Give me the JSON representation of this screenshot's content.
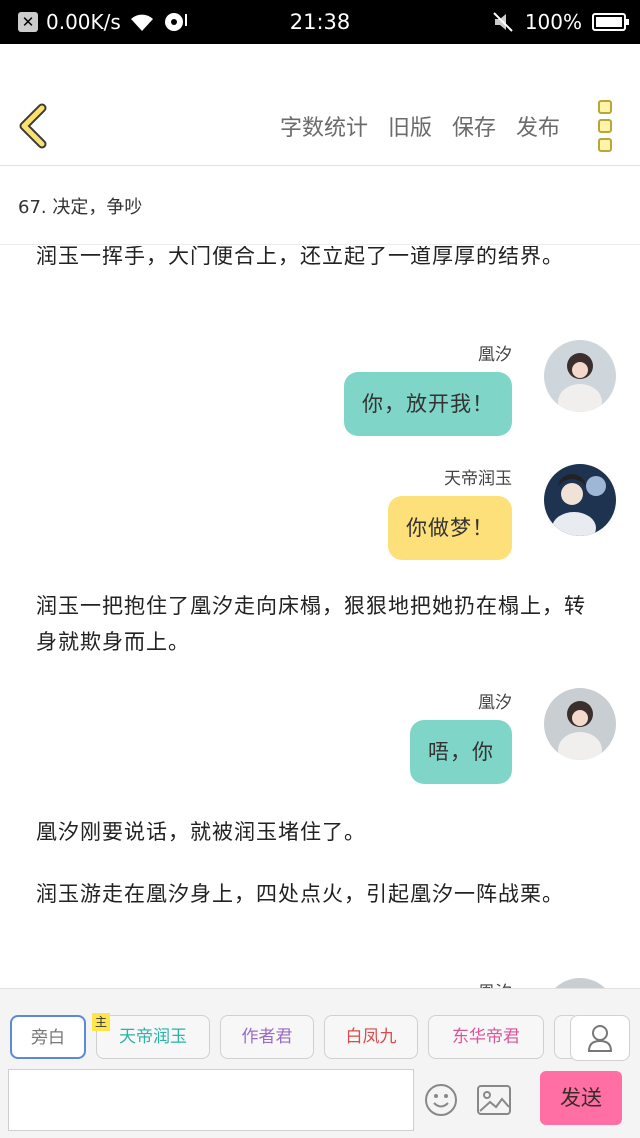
{
  "status_bar": {
    "net_speed": "0.00K/s",
    "time": "21:38",
    "battery": "100%",
    "battery_fill": 1.0
  },
  "nav": {
    "actions": [
      "字数统计",
      "旧版",
      "保存",
      "发布"
    ]
  },
  "chapter": {
    "title": "67. 决定，争吵"
  },
  "content": {
    "narration_1": "润玉一挥手，大门便合上，还立起了一道厚厚的结界。",
    "msg_1": {
      "name": "凰汐",
      "text": "你，放开我！"
    },
    "msg_2": {
      "name": "天帝润玉",
      "text": "你做梦！"
    },
    "narration_2": "润玉一把抱住了凰汐走向床榻，狠狠地把她扔在榻上，转身就欺身而上。",
    "msg_3": {
      "name": "凰汐",
      "text": "唔，你"
    },
    "narration_3": "凰汐刚要说话，就被润玉堵住了。",
    "narration_4": "润玉游走在凰汐身上，四处点火，引起凰汐一阵战栗。",
    "msg_4": {
      "name": "凰汐"
    }
  },
  "bottom": {
    "roles": [
      {
        "label": "旁白",
        "color": "#777777"
      },
      {
        "label": "天帝润玉",
        "color": "#2bb3a6"
      },
      {
        "label": "作者君",
        "color": "#9a6cc9"
      },
      {
        "label": "白凤九",
        "color": "#d94a4a"
      },
      {
        "label": "东华帝君",
        "color": "#d9559a"
      }
    ],
    "main_badge": "主",
    "send_label": "发送"
  }
}
